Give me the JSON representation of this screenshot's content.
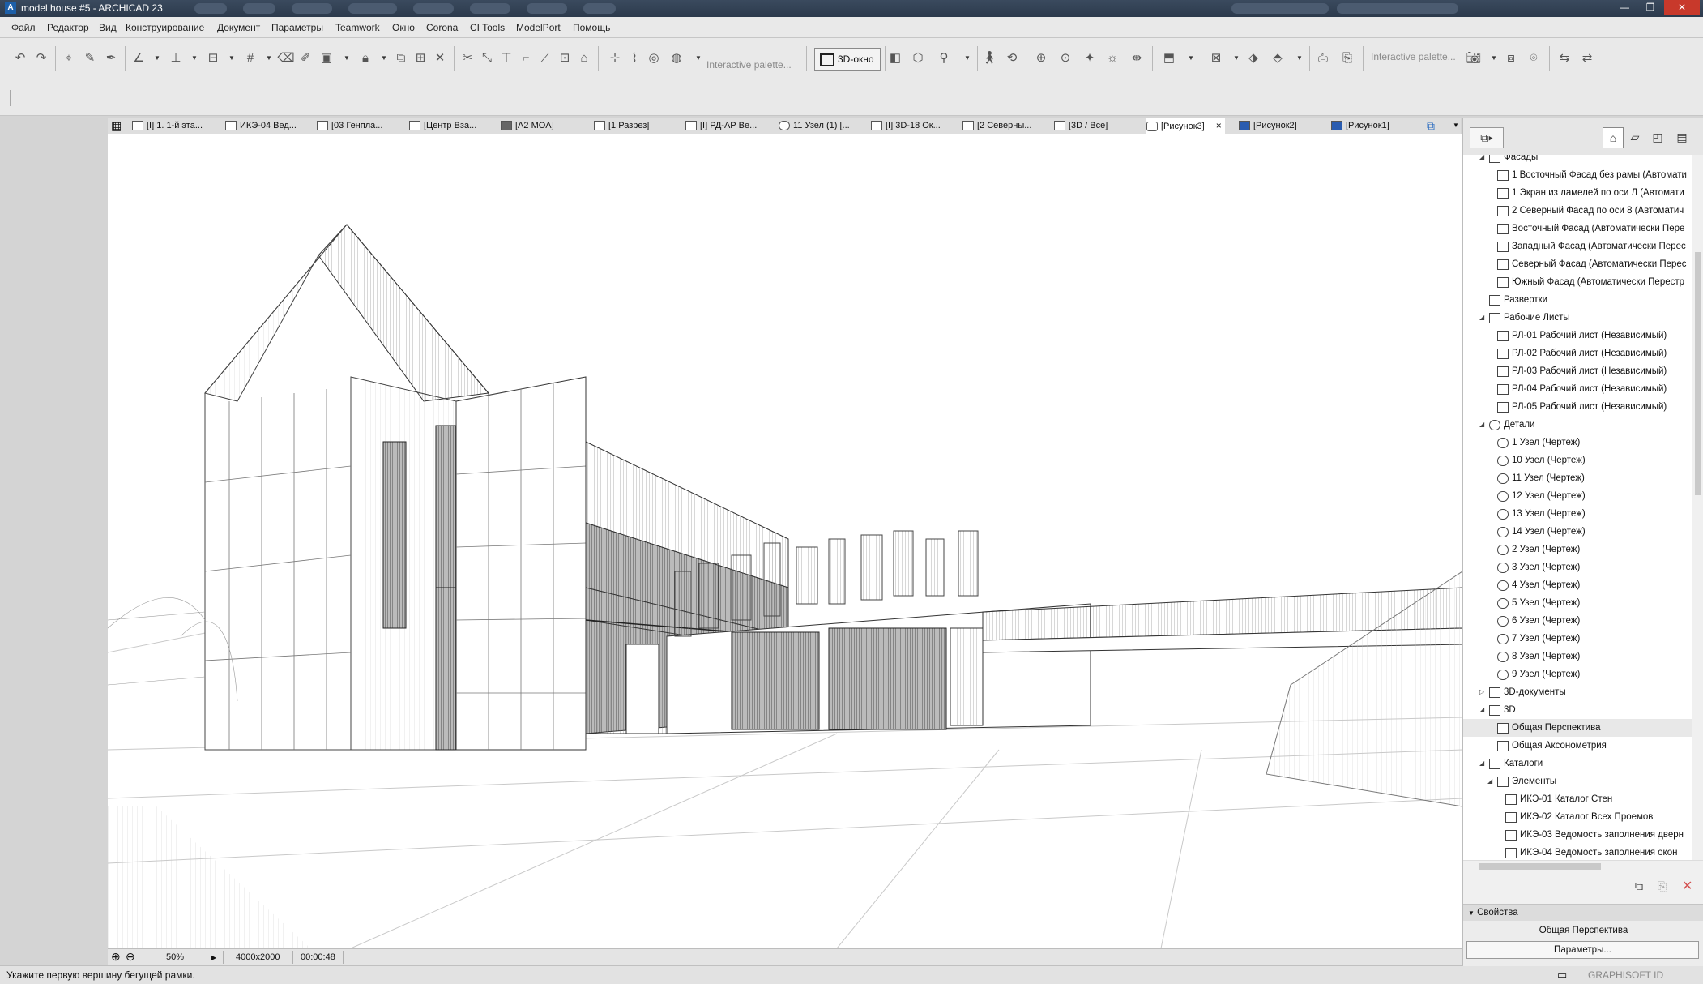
{
  "window": {
    "title": "model house #5 - ARCHICAD 23",
    "minimize": "—",
    "maximize": "❐",
    "close": "✕"
  },
  "menu": [
    "Файл",
    "Редактор",
    "Вид",
    "Конструирование",
    "Документ",
    "Параметры",
    "Teamwork",
    "Окно",
    "Corona",
    "CI Tools",
    "ModelPort",
    "Помощь"
  ],
  "toolbar": {
    "palette_1": "Interactive palette...",
    "btn_3d": "3D-окно",
    "palette_2": "Interactive palette..."
  },
  "tabs": [
    {
      "label": "[I] 1. 1-й эта...",
      "icon": "floorplan-icon"
    },
    {
      "label": "ИКЭ-04 Вед...",
      "icon": "schedule-icon"
    },
    {
      "label": "[03 Генпла...",
      "icon": "layout-icon"
    },
    {
      "label": "[Центр Вза...",
      "icon": "interior-icon"
    },
    {
      "label": "[A2 MOA]",
      "icon": "drawing-icon"
    },
    {
      "label": "[1 Разрез]",
      "icon": "section-icon"
    },
    {
      "label": "[I] РД-АР Ве...",
      "icon": "elevation-icon"
    },
    {
      "label": "11 Узел (1) [...",
      "icon": "detail-icon"
    },
    {
      "label": "[I] 3D-18 Ок...",
      "icon": "3d-doc-icon"
    },
    {
      "label": "[2 Северны...",
      "icon": "elevation-icon"
    },
    {
      "label": "[3D / Все]",
      "icon": "3d-icon"
    },
    {
      "label": "[Рисунок3]",
      "icon": "camera-icon"
    },
    {
      "label": "[Рисунок2]",
      "icon": "image-icon"
    },
    {
      "label": "[Рисунок1]",
      "icon": "image-icon"
    }
  ],
  "active_tab_close": "×",
  "view_status": {
    "zoom": "50%",
    "size": "4000x2000",
    "time": "00:00:48"
  },
  "status_text": "Укажите первую вершину бегущей рамки.",
  "graphisoft": "GRAPHISOFT ID",
  "navigator": {
    "tree": [
      {
        "label": "Фасады",
        "level": 1,
        "tw": "◢",
        "icon": "elevation-icon"
      },
      {
        "label": "1 Восточный Фасад без рамы (Автомати",
        "level": 2,
        "icon": "elevation-icon"
      },
      {
        "label": "1 Экран из ламелей по оси Л (Автомати",
        "level": 2,
        "icon": "elevation-icon"
      },
      {
        "label": "2 Северный Фасад по оси 8 (Автоматич",
        "level": 2,
        "icon": "elevation-icon"
      },
      {
        "label": "Восточный Фасад (Автоматически Пере",
        "level": 2,
        "icon": "elevation-icon"
      },
      {
        "label": "Западный Фасад (Автоматически Перес",
        "level": 2,
        "icon": "elevation-icon"
      },
      {
        "label": "Северный Фасад (Автоматически Перес",
        "level": 2,
        "icon": "elevation-icon"
      },
      {
        "label": "Южный Фасад (Автоматически Перестр",
        "level": 2,
        "icon": "elevation-icon"
      },
      {
        "label": "Развертки",
        "level": 1,
        "tw": "",
        "icon": "interior-icon"
      },
      {
        "label": "Рабочие Листы",
        "level": 1,
        "tw": "◢",
        "icon": "worksheet-icon"
      },
      {
        "label": "РЛ-01 Рабочий лист (Независимый)",
        "level": 2,
        "icon": "worksheet-icon"
      },
      {
        "label": "РЛ-02 Рабочий лист (Независимый)",
        "level": 2,
        "icon": "worksheet-icon"
      },
      {
        "label": "РЛ-03 Рабочий лист (Независимый)",
        "level": 2,
        "icon": "worksheet-icon"
      },
      {
        "label": "РЛ-04 Рабочий лист (Независимый)",
        "level": 2,
        "icon": "worksheet-icon"
      },
      {
        "label": "РЛ-05 Рабочий лист (Независимый)",
        "level": 2,
        "icon": "worksheet-icon"
      },
      {
        "label": "Детали",
        "level": 1,
        "tw": "◢",
        "icon": "detail-icon"
      },
      {
        "label": "1 Узел (Чертеж)",
        "level": 2,
        "icon": "detail-icon"
      },
      {
        "label": "10 Узел (Чертеж)",
        "level": 2,
        "icon": "detail-icon"
      },
      {
        "label": "11 Узел (Чертеж)",
        "level": 2,
        "icon": "detail-icon"
      },
      {
        "label": "12 Узел (Чертеж)",
        "level": 2,
        "icon": "detail-icon"
      },
      {
        "label": "13 Узел (Чертеж)",
        "level": 2,
        "icon": "detail-icon"
      },
      {
        "label": "14 Узел (Чертеж)",
        "level": 2,
        "icon": "detail-icon"
      },
      {
        "label": "2 Узел (Чертеж)",
        "level": 2,
        "icon": "detail-icon"
      },
      {
        "label": "3 Узел (Чертеж)",
        "level": 2,
        "icon": "detail-icon"
      },
      {
        "label": "4 Узел (Чертеж)",
        "level": 2,
        "icon": "detail-icon"
      },
      {
        "label": "5 Узел (Чертеж)",
        "level": 2,
        "icon": "detail-icon"
      },
      {
        "label": "6 Узел (Чертеж)",
        "level": 2,
        "icon": "detail-icon"
      },
      {
        "label": "7 Узел (Чертеж)",
        "level": 2,
        "icon": "detail-icon"
      },
      {
        "label": "8 Узел (Чертеж)",
        "level": 2,
        "icon": "detail-icon"
      },
      {
        "label": "9 Узел (Чертеж)",
        "level": 2,
        "icon": "detail-icon"
      },
      {
        "label": "3D-документы",
        "level": 1,
        "tw": "▷",
        "icon": "3d-doc-icon"
      },
      {
        "label": "3D",
        "level": 1,
        "tw": "◢",
        "icon": "3d-icon"
      },
      {
        "label": "Общая Перспектива",
        "level": 2,
        "icon": "perspective-icon",
        "selected": true
      },
      {
        "label": "Общая Аксонометрия",
        "level": 2,
        "icon": "axonometry-icon"
      },
      {
        "label": "Каталоги",
        "level": 1,
        "tw": "◢",
        "icon": "schedule-icon"
      },
      {
        "label": "Элементы",
        "level": 2,
        "tw": "◢",
        "icon": "folder-icon"
      },
      {
        "label": "ИКЭ-01 Каталог Стен",
        "level": 3,
        "icon": "schedule-icon"
      },
      {
        "label": "ИКЭ-02 Каталог Всех Проемов",
        "level": 3,
        "icon": "schedule-icon"
      },
      {
        "label": "ИКЭ-03 Ведомость заполнения дверн",
        "level": 3,
        "icon": "schedule-icon"
      },
      {
        "label": "ИКЭ-04 Ведомость заполнения окон",
        "level": 3,
        "icon": "schedule-icon"
      }
    ],
    "properties_header": "Свойства",
    "properties_value": "Общая Перспектива",
    "properties_button": "Параметры..."
  }
}
